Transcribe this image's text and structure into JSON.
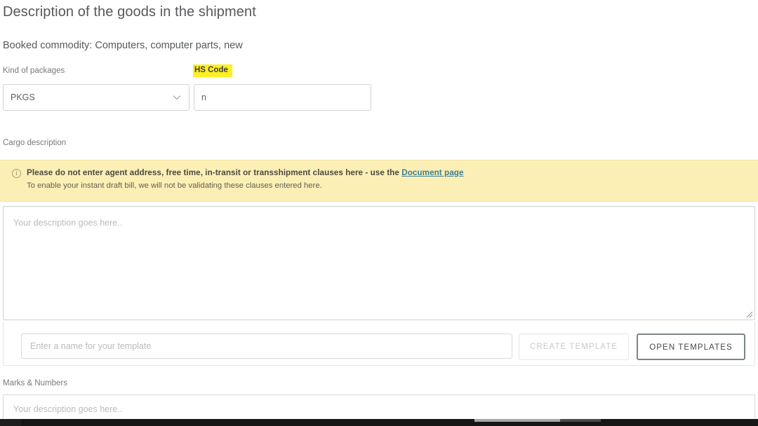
{
  "section": {
    "title": "Description of the goods in the shipment",
    "booked_commodity": "Booked commodity: Computers, computer parts, new"
  },
  "fields": {
    "kind_of_packages": {
      "label": "Kind of packages",
      "value": "PKGS",
      "chevron_icon": "chevron-down-icon"
    },
    "hs_code": {
      "label": "HS Code",
      "value": "n",
      "placeholder": "",
      "highlight_color": "#ffef23"
    },
    "cargo_description": {
      "label": "Cargo description",
      "value": "",
      "placeholder": "Your description goes here.."
    },
    "marks_and_numbers": {
      "label": "Marks & Numbers",
      "value": "",
      "placeholder": "Your description goes here.."
    }
  },
  "alert": {
    "icon": "info-circle-icon",
    "icon_glyph": "i",
    "line1_before_link": "Please do not enter agent address, free time, in-transit or transshipment clauses here - use the ",
    "line1_link": "Document page",
    "line2": "To enable your instant draft bill, we will not be validating these clauses entered here.",
    "background_color": "#fcefb6",
    "link_color": "#3b7f93"
  },
  "template": {
    "name_placeholder": "Enter a name for your template",
    "name_value": "",
    "create_label": "CREATE TEMPLATE",
    "open_label": "OPEN TEMPLATES"
  }
}
